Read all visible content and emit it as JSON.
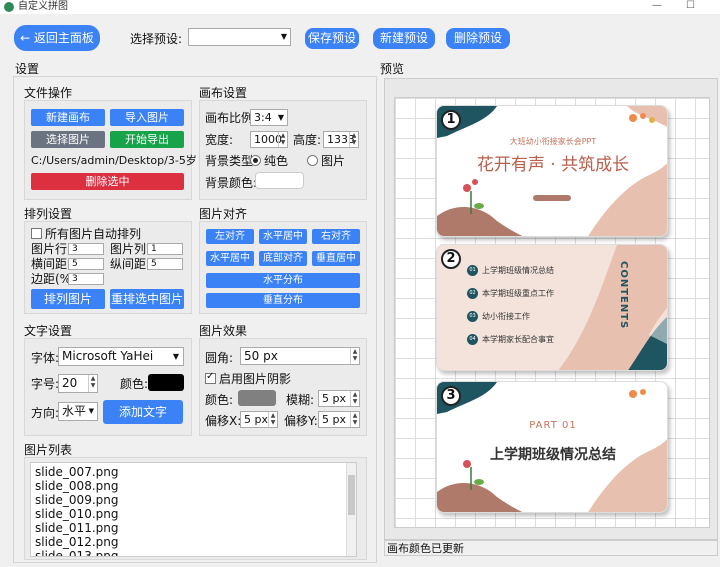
{
  "window": {
    "title": "自定义拼图",
    "minimize": "—",
    "maximize": "☐"
  },
  "toolbar": {
    "back_label": "← 返回主面板",
    "preset_label": "选择预设:",
    "preset_value": "",
    "save_preset": "保存预设",
    "new_preset": "新建预设",
    "delete_preset": "删除预设"
  },
  "settings": {
    "title": "设置",
    "file_ops": {
      "title": "文件操作",
      "new_canvas": "新建画布",
      "import_images": "导入图片",
      "select_images": "选择图片",
      "export": "开始导出",
      "path": "C:/Users/admin/Desktop/3-5岁",
      "delete_selected": "删除选中"
    },
    "canvas": {
      "title": "画布设置",
      "ratio_label": "画布比例",
      "ratio_value": "3:4",
      "width_label": "宽度:",
      "width_value": "1000",
      "height_label": "高度:",
      "height_value": "1333",
      "bg_type_label": "背景类型",
      "bg_solid": "纯色",
      "bg_image": "图片",
      "bg_color_label": "背景颜色:",
      "bg_color": "#ffffff"
    },
    "arrange": {
      "title": "排列设置",
      "auto_label": "所有图片自动排列",
      "rows_label": "图片行数",
      "rows_value": "3",
      "cols_label": "图片列数",
      "cols_value": "1",
      "hgap_label": "横间距(%)",
      "hgap_value": "5",
      "vgap_label": "纵间距(%)",
      "vgap_value": "5",
      "margin_label": "边距(%)",
      "margin_value": "3",
      "arrange_btn": "排列图片",
      "rearrange_btn": "重排选中图片"
    },
    "align": {
      "title": "图片对齐",
      "left": "左对齐",
      "hcenter": "水平居中",
      "right": "右对齐",
      "h_center": "水平居中",
      "bottom": "底部对齐",
      "v_center": "垂直居中",
      "h_distribute": "水平分布",
      "v_distribute": "垂直分布"
    },
    "text": {
      "title": "文字设置",
      "font_label": "字体:",
      "font_value": "Microsoft YaHei",
      "size_label": "字号:",
      "size_value": "20",
      "color_label": "颜色:",
      "color": "#000000",
      "direction_label": "方向:",
      "direction_value": "水平",
      "add_text": "添加文字"
    },
    "effects": {
      "title": "图片效果",
      "radius_label": "圆角:",
      "radius_value": "50 px",
      "shadow_label": "启用图片阴影",
      "shadow_color_label": "颜色:",
      "shadow_color": "#808080",
      "blur_label": "模糊:",
      "blur_value": "5 px",
      "offx_label": "偏移X:",
      "offx_value": "5 px",
      "offy_label": "偏移Y:",
      "offy_value": "5 px"
    },
    "list": {
      "title": "图片列表",
      "items": [
        "slide_007.png",
        "slide_008.png",
        "slide_009.png",
        "slide_010.png",
        "slide_011.png",
        "slide_012.png",
        "slide_013.png"
      ]
    }
  },
  "preview": {
    "title": "预览",
    "status": "画布颜色已更新",
    "slides": [
      {
        "num": "1",
        "subtitle": "大班幼小衔接家长会PPT",
        "title": "花开有声 · 共筑成长"
      },
      {
        "num": "2",
        "contents": "CONTENTS",
        "items": [
          {
            "n": "01",
            "t": "上学期班级情况总结"
          },
          {
            "n": "02",
            "t": "本学期班级重点工作"
          },
          {
            "n": "03",
            "t": "幼小衔接工作"
          },
          {
            "n": "04",
            "t": "本学期家长配合事宜"
          }
        ]
      },
      {
        "num": "3",
        "part": "PART 01",
        "title": "上学期班级情况总结"
      }
    ]
  }
}
